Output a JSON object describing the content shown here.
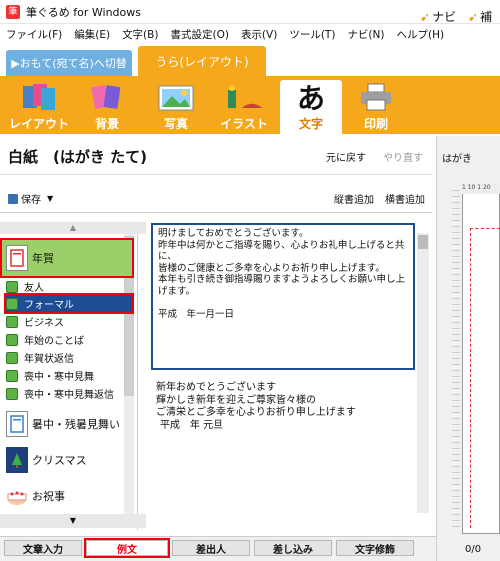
{
  "window": {
    "title": "筆ぐるめ for Windows"
  },
  "menu": [
    "ファイル(F)",
    "編集(E)",
    "文字(B)",
    "書式設定(O)",
    "表示(V)",
    "ツール(T)",
    "ナビ(N)",
    "ヘルプ(H)"
  ],
  "mode_tabs": {
    "front": "▶おもて(宛て名)へ切替",
    "back": "うら(レイアウト)"
  },
  "navi": {
    "navi_label": "ナビ",
    "supplement_label": "補"
  },
  "toolbar": [
    {
      "label": "レイアウト",
      "icon": "layout-icon"
    },
    {
      "label": "背景",
      "icon": "background-icon"
    },
    {
      "label": "写真",
      "icon": "photo-icon"
    },
    {
      "label": "イラスト",
      "icon": "illustration-icon"
    },
    {
      "label": "文字",
      "icon": "text-icon",
      "active": true
    },
    {
      "label": "印刷",
      "icon": "printer-icon"
    }
  ],
  "doc_title": "白紙　(はがき たて)",
  "undo": "元に戻す",
  "redo": "やり直す",
  "save": "保存",
  "vertical_add": "縦書追加",
  "horizontal_add": "横書追加",
  "categories": {
    "nenga": "年賀",
    "sub_items": [
      "友人",
      "フォーマル",
      "ビジネス",
      "年始のことば",
      "年賀状返信",
      "喪中・寒中見舞",
      "喪中・寒中見舞返信"
    ],
    "selected_sub": "フォーマル",
    "shochu": "暑中・残暑見舞い",
    "christmas": "クリスマス",
    "oiwai": "お祝事"
  },
  "editor_lines": [
    "明けましておめでとうございます。",
    "昨年中は何かとご指導を賜り、心よりお礼申し上げると共に、",
    "皆様のご健康とご多幸を心よりお祈り申し上げます。",
    "本年も引き続き御指導賜りますようよろしくお願い申し上げます。",
    "",
    "平成　年一月一日"
  ],
  "sample_lines": [
    "新年おめでとうございます",
    "輝かしき新年を迎えご尊家皆々様の",
    "ご清栄とご多幸を心よりお祈り申し上げます",
    "平成　年 元旦"
  ],
  "preview": {
    "label": "はがき",
    "ruler": "1 10 1 20",
    "status": "0/0"
  },
  "bottom_tabs": [
    "文章入力",
    "例文",
    "差出人",
    "差し込み",
    "文字修飾"
  ],
  "selected_bottom_tab": "例文",
  "colors": {
    "toolbar": "#f5a81c",
    "selection": "#1d4e94",
    "highlight": "#e01",
    "category_selected": "#9ccf6a"
  }
}
